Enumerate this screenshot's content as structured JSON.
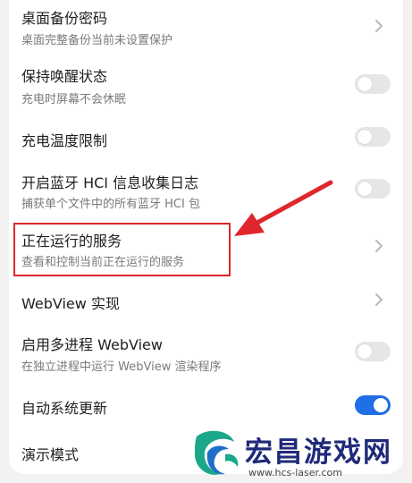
{
  "settings": [
    {
      "title": "桌面备份密码",
      "subtitle": "桌面完整备份当前未设置保护",
      "control": "chevron"
    },
    {
      "title": "保持唤醒状态",
      "subtitle": "充电时屏幕不会休眠",
      "control": "toggle",
      "on": false
    },
    {
      "title": "充电温度限制",
      "control": "toggle",
      "on": false
    },
    {
      "title": "开启蓝牙 HCI 信息收集日志",
      "subtitle": "捕获单个文件中的所有蓝牙 HCI 包",
      "control": "toggle",
      "on": false
    },
    {
      "title": "正在运行的服务",
      "subtitle": "查看和控制当前正在运行的服务",
      "control": "chevron"
    },
    {
      "title": "WebView 实现",
      "control": "chevron"
    },
    {
      "title": "启用多进程 WebView",
      "subtitle": "在独立进程中运行 WebView 渲染程序",
      "control": "toggle",
      "on": false
    },
    {
      "title": "自动系统更新",
      "control": "toggle",
      "on": true
    },
    {
      "title": "演示模式"
    }
  ],
  "watermark": {
    "text": "宏昌游戏网",
    "url": "www.hcs-laser.com"
  },
  "colors": {
    "accent": "#1f6fe6",
    "highlight": "#e0262d",
    "arrow": "#e0262d"
  }
}
